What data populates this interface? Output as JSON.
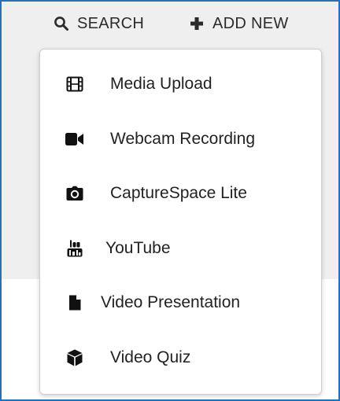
{
  "header": {
    "search_label": "SEARCH",
    "add_new_label": "ADD NEW"
  },
  "add_new_menu": {
    "items": [
      {
        "label": "Media Upload",
        "icon": "film-icon"
      },
      {
        "label": "Webcam Recording",
        "icon": "video-camera-icon"
      },
      {
        "label": "CaptureSpace Lite",
        "icon": "camera-icon"
      },
      {
        "label": "YouTube",
        "icon": "youtube-icon"
      },
      {
        "label": "Video Presentation",
        "icon": "file-icon"
      },
      {
        "label": "Video Quiz",
        "icon": "cube-icon"
      }
    ]
  },
  "colors": {
    "frame_border": "#2a6fb3",
    "page_background": "#efefef",
    "text": "#222222"
  }
}
